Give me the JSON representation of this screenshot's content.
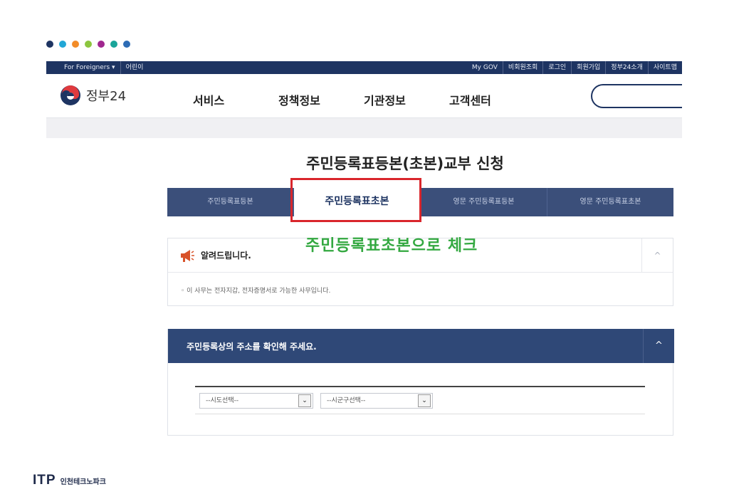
{
  "dots": [
    "#1e3462",
    "#22a7d6",
    "#f28c28",
    "#8cc63f",
    "#a0278f",
    "#1aa59a",
    "#2d6cb5"
  ],
  "topbar": {
    "left": [
      "For Foreigners ▾",
      "어린이"
    ],
    "right": [
      "My GOV",
      "비회원조회",
      "로그인",
      "회원가입",
      "정부24소개",
      "사이트맵"
    ]
  },
  "header": {
    "logo_text": "정부24",
    "nav": [
      "서비스",
      "정책정보",
      "기관정보",
      "고객센터"
    ]
  },
  "page_title": "주민등록표등본(초본)교부 신청",
  "tabs": [
    {
      "label": "주민등록표등본",
      "active": false
    },
    {
      "label": "주민등록표초본",
      "active": true
    },
    {
      "label": "영문 주민등록표등본",
      "active": false
    },
    {
      "label": "영문 주민등록표초본",
      "active": false
    }
  ],
  "annotation": "주민등록표초본으로 체크",
  "notice": {
    "title": "알려드립니다.",
    "toggle": "^",
    "text": "◦ 이 사무는 전자지갑, 전자증명서로 가능한 사무입니다."
  },
  "address": {
    "title": "주민등록상의 주소를 확인해 주세요.",
    "toggle": "^",
    "sido": "--시도선택--",
    "sigungu": "--시군구선택--"
  },
  "footer": {
    "brand": "ITP",
    "sub": "인천테크노파크"
  }
}
